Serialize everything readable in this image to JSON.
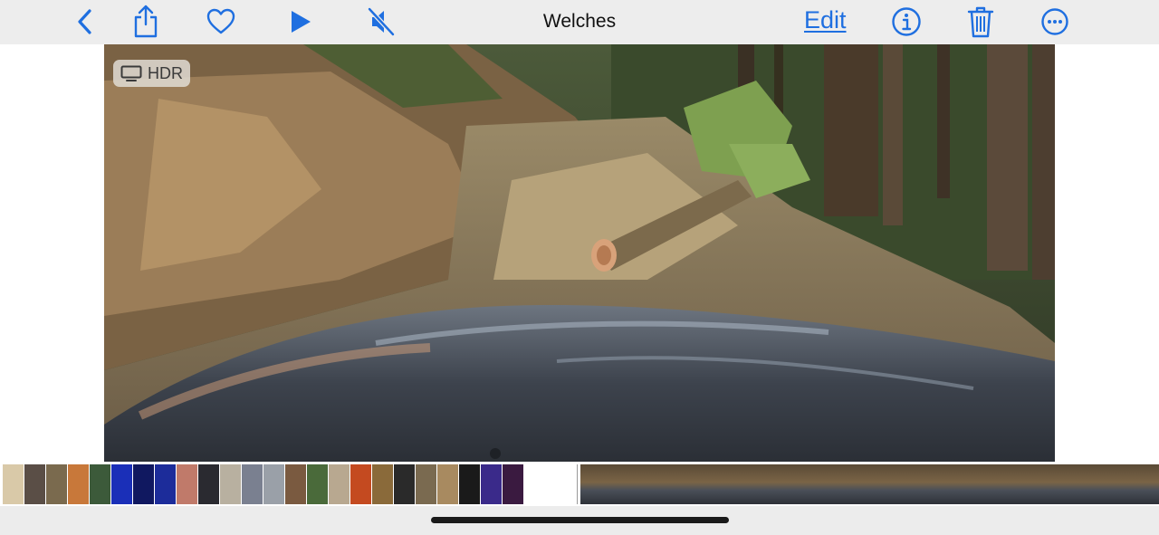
{
  "toolbar": {
    "title": "Welches",
    "edit_label": "Edit",
    "accent": "#1f6fe0",
    "icons": [
      "chevron-left-icon",
      "share-icon",
      "heart-icon",
      "play-icon",
      "speaker-muted-icon",
      "info-icon",
      "trash-icon",
      "more-icon"
    ]
  },
  "photo": {
    "hdr_label": "HDR"
  },
  "filmstrip": {
    "thumb_colors": [
      "#d9c9a8",
      "#5a4e46",
      "#7a6a4e",
      "#c8783a",
      "#3c5a3a",
      "#1a2fb8",
      "#101860",
      "#1c2c9a",
      "#c07a6a",
      "#2a2a30",
      "#b8b0a0",
      "#7a8090",
      "#9aa0a8",
      "#7a5a40",
      "#4a6a3a",
      "#b8a890",
      "#c44a20",
      "#8a6a3a",
      "#2a2a2a",
      "#7a6a50",
      "#a88a60",
      "#1a1a1a",
      "#3a2a8a",
      "#3a1a40"
    ]
  }
}
